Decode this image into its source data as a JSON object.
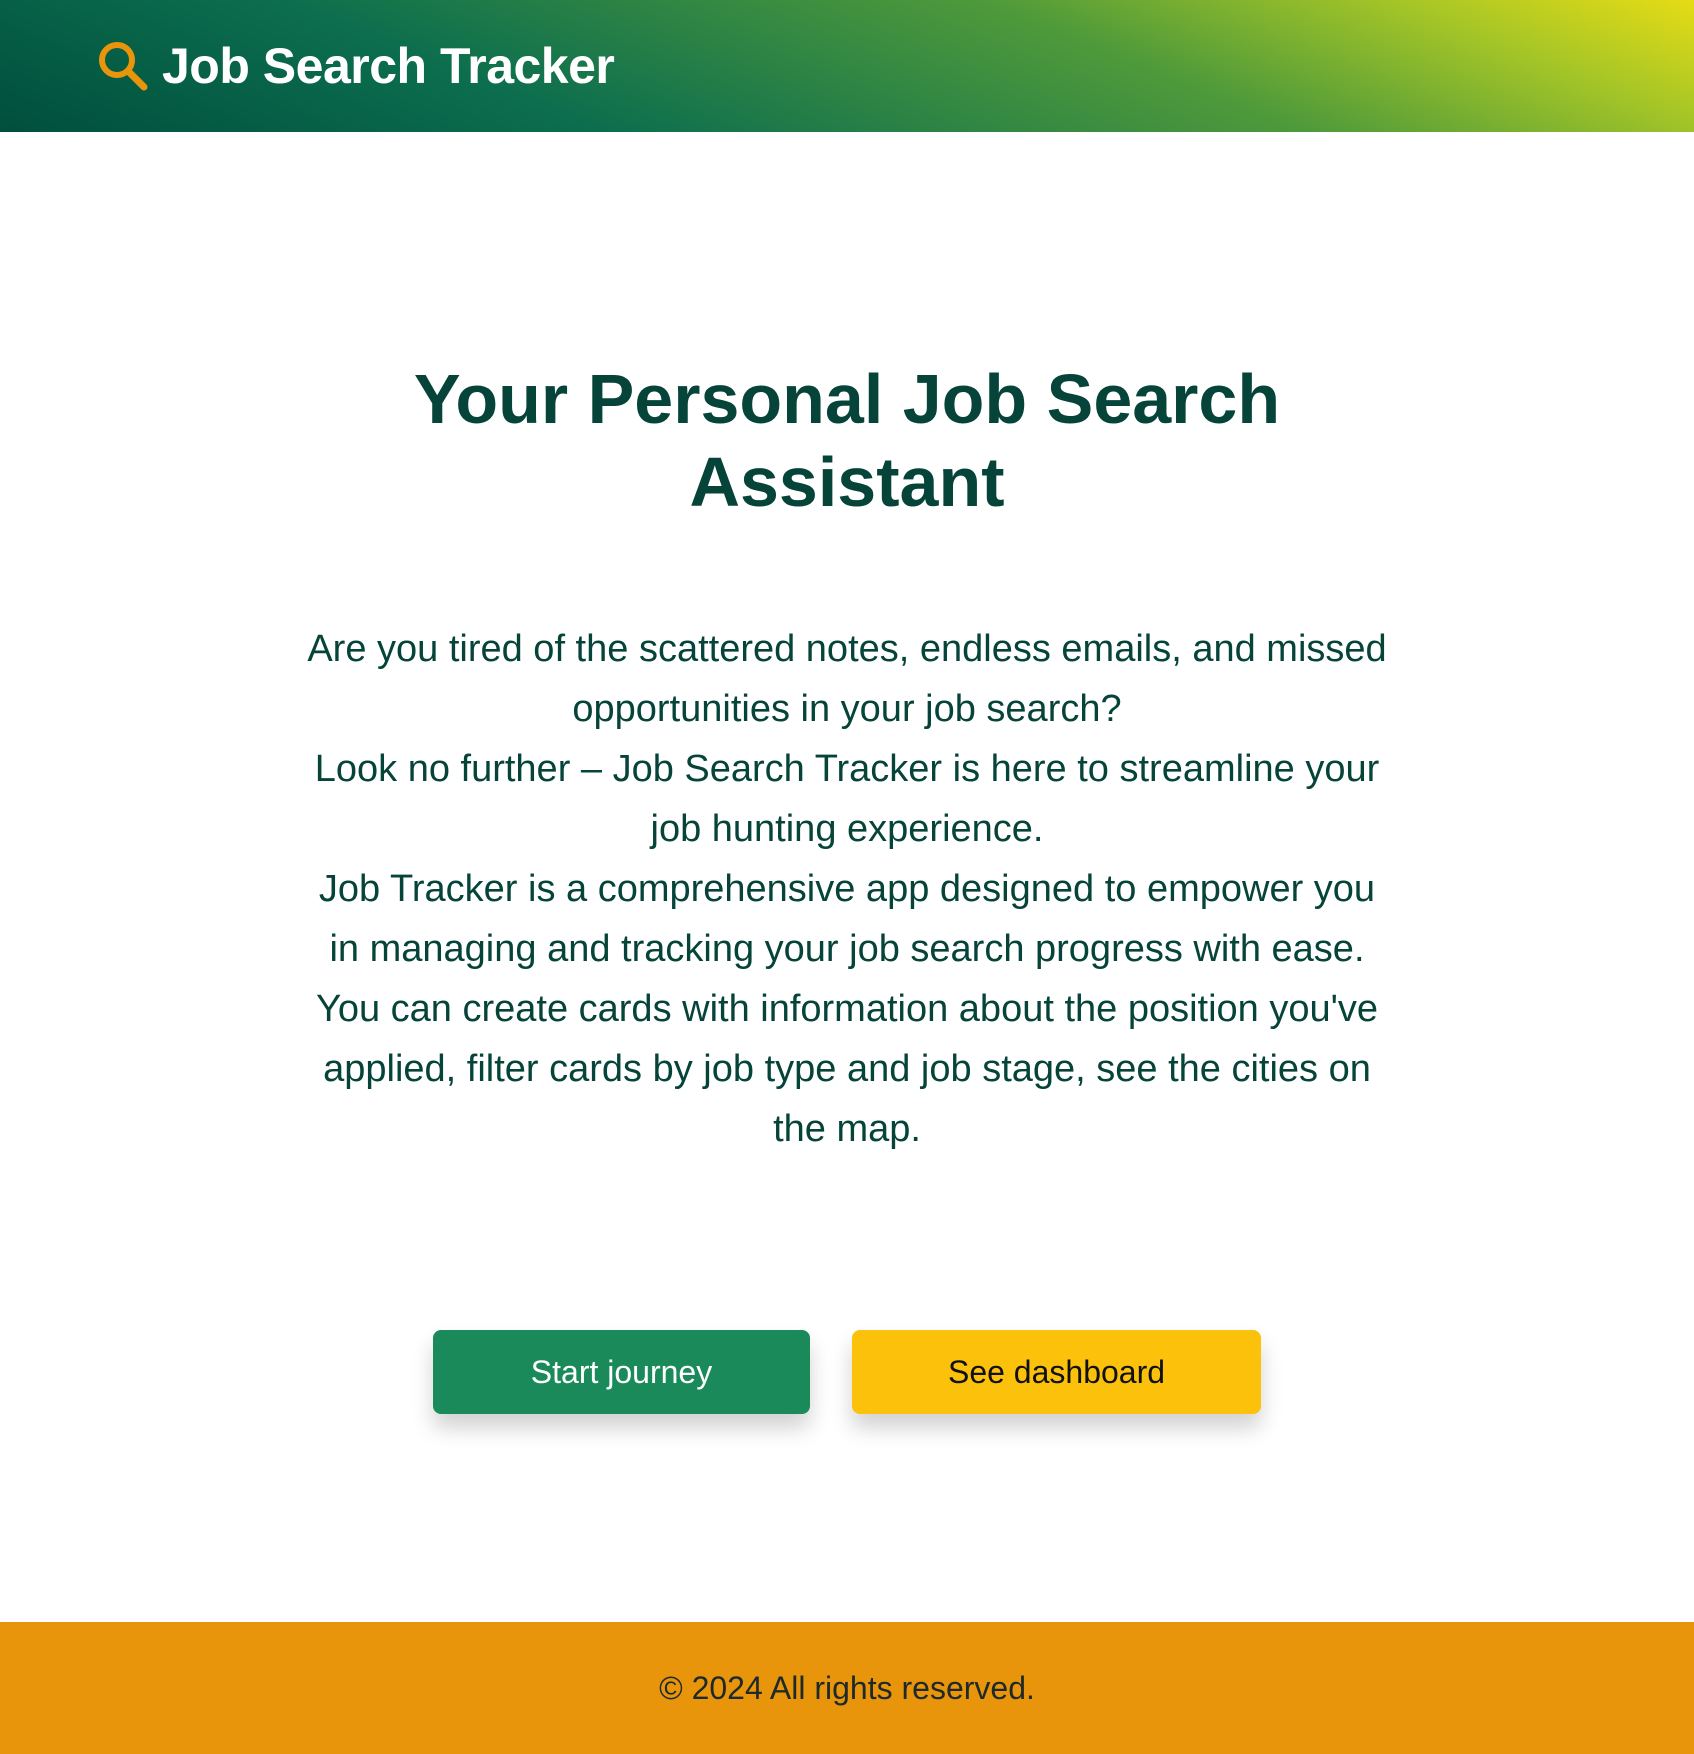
{
  "header": {
    "title": "Job Search Tracker",
    "icon": "search-icon"
  },
  "hero": {
    "title": "Your Personal Job Search Assistant",
    "paragraphs": [
      "Are you tired of the scattered notes, endless emails, and missed opportunities in your job search?",
      "Look no further – Job Search Tracker is here to streamline your job hunting experience.",
      "Job Tracker is a comprehensive app designed to empower you in managing and tracking your job search progress with ease.",
      "You can create cards with information about the position you've applied, filter cards by job type and job stage, see the cities on the map."
    ],
    "buttons": {
      "start_label": "Start journey",
      "dashboard_label": "See dashboard"
    }
  },
  "footer": {
    "text": "© 2024 All rights reserved."
  },
  "colors": {
    "primary_green": "#1b8a5a",
    "dark_green_text": "#06443a",
    "accent_yellow": "#fcc10b",
    "footer_orange": "#e8950b",
    "icon_orange": "#e8950b"
  }
}
